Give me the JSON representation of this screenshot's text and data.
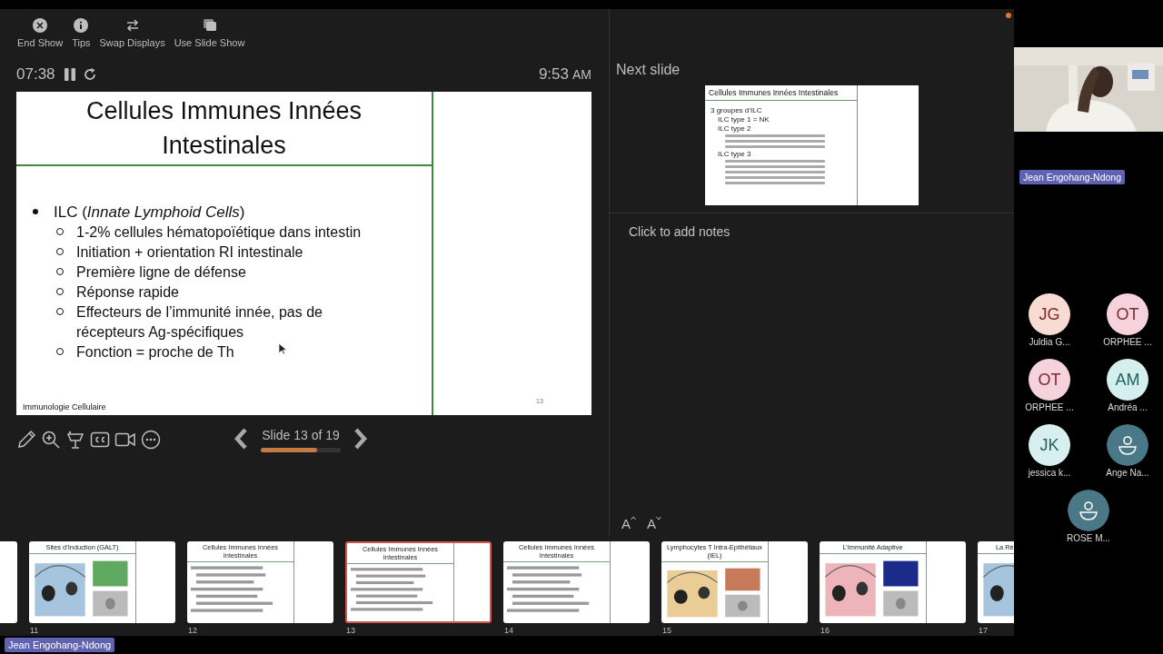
{
  "toolbar": [
    {
      "kind": "end",
      "label": "End Show"
    },
    {
      "kind": "tips",
      "label": "Tips"
    },
    {
      "kind": "swap",
      "label": "Swap Displays"
    },
    {
      "kind": "slideshow",
      "label": "Use Slide Show"
    }
  ],
  "timer": {
    "elapsed": "07:38",
    "clock": "9:53",
    "clock_suffix": "AM"
  },
  "current_slide": {
    "title": "Cellules Immunes Innées Intestinales",
    "bullets": [
      {
        "text": "ILC (*Innate Lymphoid Cells*)",
        "children": [
          {
            "text": "1-2% cellules hématopoïétique dans intestin"
          },
          {
            "text": "Initiation + orientation RI intestinale"
          },
          {
            "text": "Première ligne de défense"
          },
          {
            "text": "Réponse rapide"
          },
          {
            "text": "Effecteurs de l’immunité innée, pas de récepteurs Ag-spécifiques"
          },
          {
            "text": "Fonction = proche de Th"
          }
        ]
      }
    ],
    "footer": "Immunologie Cellulaire",
    "page": "13"
  },
  "tools": [
    {
      "kind": "pen"
    },
    {
      "kind": "zoom"
    },
    {
      "kind": "laser"
    },
    {
      "kind": "cc"
    },
    {
      "kind": "camera"
    },
    {
      "kind": "more"
    }
  ],
  "navigation": {
    "position": "Slide 13 of 19",
    "level": 0.7
  },
  "next_slide": {
    "label": "Next slide",
    "title": "Cellules Immunes Innées Intestinales",
    "bullets": [
      {
        "text": "3 groupes d’ILC",
        "children": [
          {
            "text": "ILC type 1 = NK"
          },
          {
            "text": "ILC type 2",
            "children": [
              {
                "kind": "blurred"
              },
              {
                "kind": "blurred"
              },
              {
                "kind": "blurred"
              }
            ]
          },
          {
            "text": "ILC type 3",
            "children": [
              {
                "kind": "blurred"
              },
              {
                "kind": "blurred"
              },
              {
                "kind": "blurred"
              },
              {
                "kind": "blurred"
              },
              {
                "kind": "blurred"
              }
            ]
          }
        ]
      }
    ]
  },
  "notes": {
    "placeholder": "Click to add notes"
  },
  "font_buttons": [
    {
      "kind": "increase",
      "label": "A"
    },
    {
      "kind": "decrease",
      "label": "A"
    }
  ],
  "thumbnails": [
    {
      "kind": "partial",
      "selected": false
    },
    {
      "number": "11",
      "title": "Sites d’Induction (GALT)",
      "kind": "figure",
      "selected": false
    },
    {
      "number": "12",
      "title": "Cellules Immunes Innées Intestinales",
      "kind": "text",
      "selected": false
    },
    {
      "number": "13",
      "title": "Cellules Immunes Innées Intestinales",
      "kind": "text",
      "selected": true
    },
    {
      "number": "14",
      "title": "Cellules Immunes Innées Intestinales",
      "kind": "text",
      "selected": false
    },
    {
      "number": "15",
      "title": "Lymphocytes T Intra-Epithéliaux (IEL)",
      "kind": "figure",
      "selected": false
    },
    {
      "number": "16",
      "title": "L’Immunité Adaptive",
      "kind": "figure",
      "selected": false
    },
    {
      "number": "17",
      "title": "La Ré",
      "kind": "figure",
      "selected": false
    }
  ],
  "presenter": {
    "name": "Jean Engohang-Ndong"
  },
  "attendees": [
    {
      "kind": "initials",
      "initials": "JG",
      "name": "Juldia G...",
      "color": "#f8dcd3"
    },
    {
      "kind": "initials",
      "initials": "OT",
      "name": "ORPHEE ...",
      "color": "#f6d3dc"
    },
    {
      "kind": "initials",
      "initials": "OT",
      "name": "ORPHEE ...",
      "color": "#f6d3dc"
    },
    {
      "kind": "initials",
      "initials": "AM",
      "name": "Andréa ...",
      "color": "#d5eeee"
    },
    {
      "kind": "initials",
      "initials": "JK",
      "name": "jessica k...",
      "color": "#d8efef"
    },
    {
      "kind": "generic",
      "name": "Ange Na...",
      "color": "#4b7886"
    },
    {
      "kind": "generic",
      "name": "ROSE M...",
      "color": "#4b7886"
    }
  ],
  "speaker_badge": {
    "name": "Jean Engohang-Ndong"
  }
}
